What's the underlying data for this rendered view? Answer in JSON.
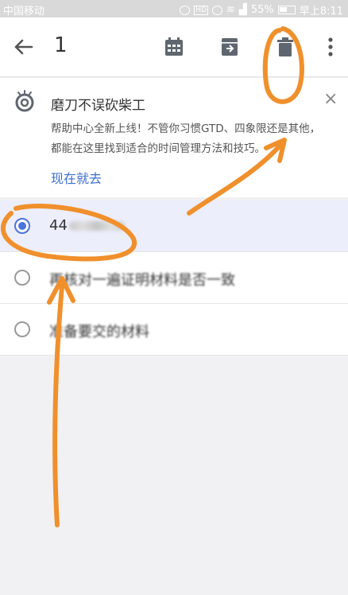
{
  "status_bar": {
    "carrier": "中国移动",
    "hd_badge": "HD",
    "battery_percent": "55%",
    "time": "早上8:11"
  },
  "toolbar": {
    "title": "1",
    "icons": [
      "back-arrow-icon",
      "calendar-icon",
      "archive-icon",
      "trash-icon",
      "more-vert-icon"
    ]
  },
  "banner": {
    "title": "磨刀不误砍柴工",
    "body": "帮助中心全新上线！不管你习惯GTD、四象限还是其他，都能在这里找到适合的时间管理方法和技巧。",
    "link": "现在就去",
    "close": "×"
  },
  "tasks": [
    {
      "text_visible": "44",
      "selected": true
    },
    {
      "text_visible": "再核对一遍证明材料是否一致",
      "selected": false
    },
    {
      "text_visible": "准备要交的材料",
      "selected": false
    }
  ],
  "colors": {
    "accent_blue": "#4a74e0",
    "link_blue": "#3d6fd1",
    "annotation_orange": "#f0902c",
    "selected_row": "#eceefb"
  }
}
